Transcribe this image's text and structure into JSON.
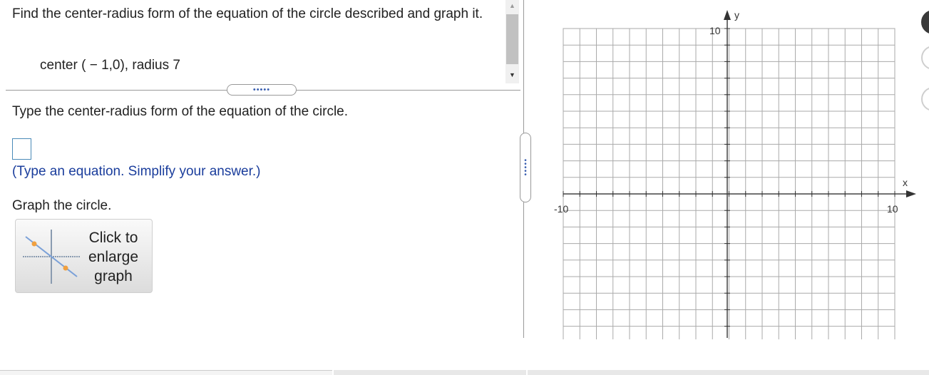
{
  "question": {
    "text": "Find the center-radius form of the equation of the circle described and graph it.",
    "given": "center ( − 1,0), radius 7"
  },
  "part1": {
    "instruction": "Type the center-radius form of the equation of the circle.",
    "answer_value": "",
    "hint": "(Type an equation. Simplify your answer.)"
  },
  "part2": {
    "instruction": "Graph the circle.",
    "enlarge_button_label": "Click to enlarge graph"
  },
  "graph": {
    "x_axis_label": "x",
    "y_axis_label": "y",
    "x_min_label": "-10",
    "x_max_label": "10",
    "y_max_label": "10",
    "x_range": [
      -10,
      10
    ],
    "y_range": [
      -10,
      10
    ],
    "grid": true
  },
  "colors": {
    "hint_text": "#1a3d9c",
    "answer_border": "#4a8ab8",
    "divider_dots": "#3a5fb0"
  }
}
